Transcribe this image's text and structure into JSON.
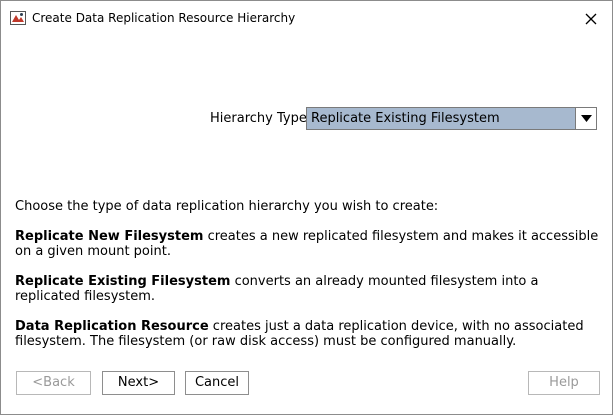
{
  "window": {
    "title": "Create Data Replication Resource Hierarchy",
    "icons": {
      "app": "steeleye-app-icon",
      "close": "close-icon"
    }
  },
  "hierarchy": {
    "label": "Hierarchy Type",
    "selected": "Replicate Existing Filesystem"
  },
  "description": {
    "intro": "Choose the type of data replication hierarchy you wish to create:",
    "options": [
      {
        "name": "Replicate New Filesystem",
        "text": " creates a new replicated filesystem and makes it accessible on a given mount point."
      },
      {
        "name": "Replicate Existing Filesystem",
        "text": " converts an already mounted filesystem into a replicated filesystem."
      },
      {
        "name": "Data Replication Resource",
        "text": " creates just a data replication device, with no associated filesystem. The filesystem (or raw disk access) must be configured manually."
      }
    ]
  },
  "buttons": {
    "back": "<Back",
    "next": "Next>",
    "cancel": "Cancel",
    "help": "Help"
  },
  "colors": {
    "selection": "#a7b9cf",
    "disabled_text": "#9a9a9a"
  }
}
